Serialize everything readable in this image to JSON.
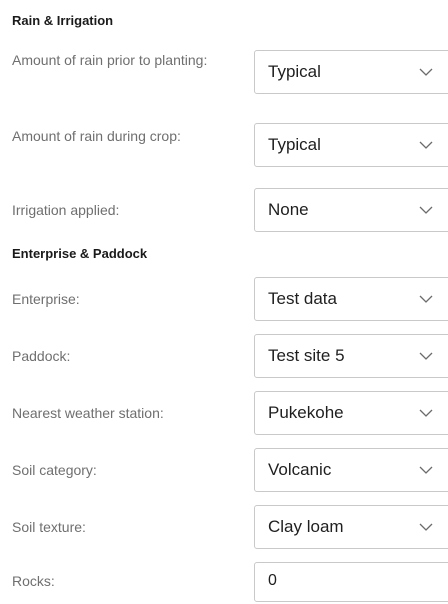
{
  "sections": {
    "rain": {
      "title": "Rain & Irrigation"
    },
    "enterprise": {
      "title": "Enterprise & Paddock"
    }
  },
  "fields": {
    "rain_prior": {
      "label": "Amount of rain prior to planting:",
      "value": "Typical",
      "icon": "chevron-down-icon"
    },
    "rain_during": {
      "label": "Amount of rain during crop:",
      "value": "Typical",
      "icon": "chevron-down-icon"
    },
    "irrigation": {
      "label": "Irrigation applied:",
      "value": "None",
      "icon": "chevron-down-icon"
    },
    "enterprise": {
      "label": "Enterprise:",
      "value": "Test data",
      "icon": "chevron-down-icon"
    },
    "paddock": {
      "label": "Paddock:",
      "value": "Test site 5",
      "icon": "chevron-down-icon"
    },
    "weather_station": {
      "label": "Nearest weather station:",
      "value": "Pukekohe",
      "icon": "chevron-down-icon"
    },
    "soil_category": {
      "label": "Soil category:",
      "value": "Volcanic",
      "icon": "chevron-down-icon"
    },
    "soil_texture": {
      "label": "Soil texture:",
      "value": "Clay loam",
      "icon": "chevron-down-icon"
    },
    "rocks": {
      "label": "Rocks:",
      "value": "0"
    }
  }
}
